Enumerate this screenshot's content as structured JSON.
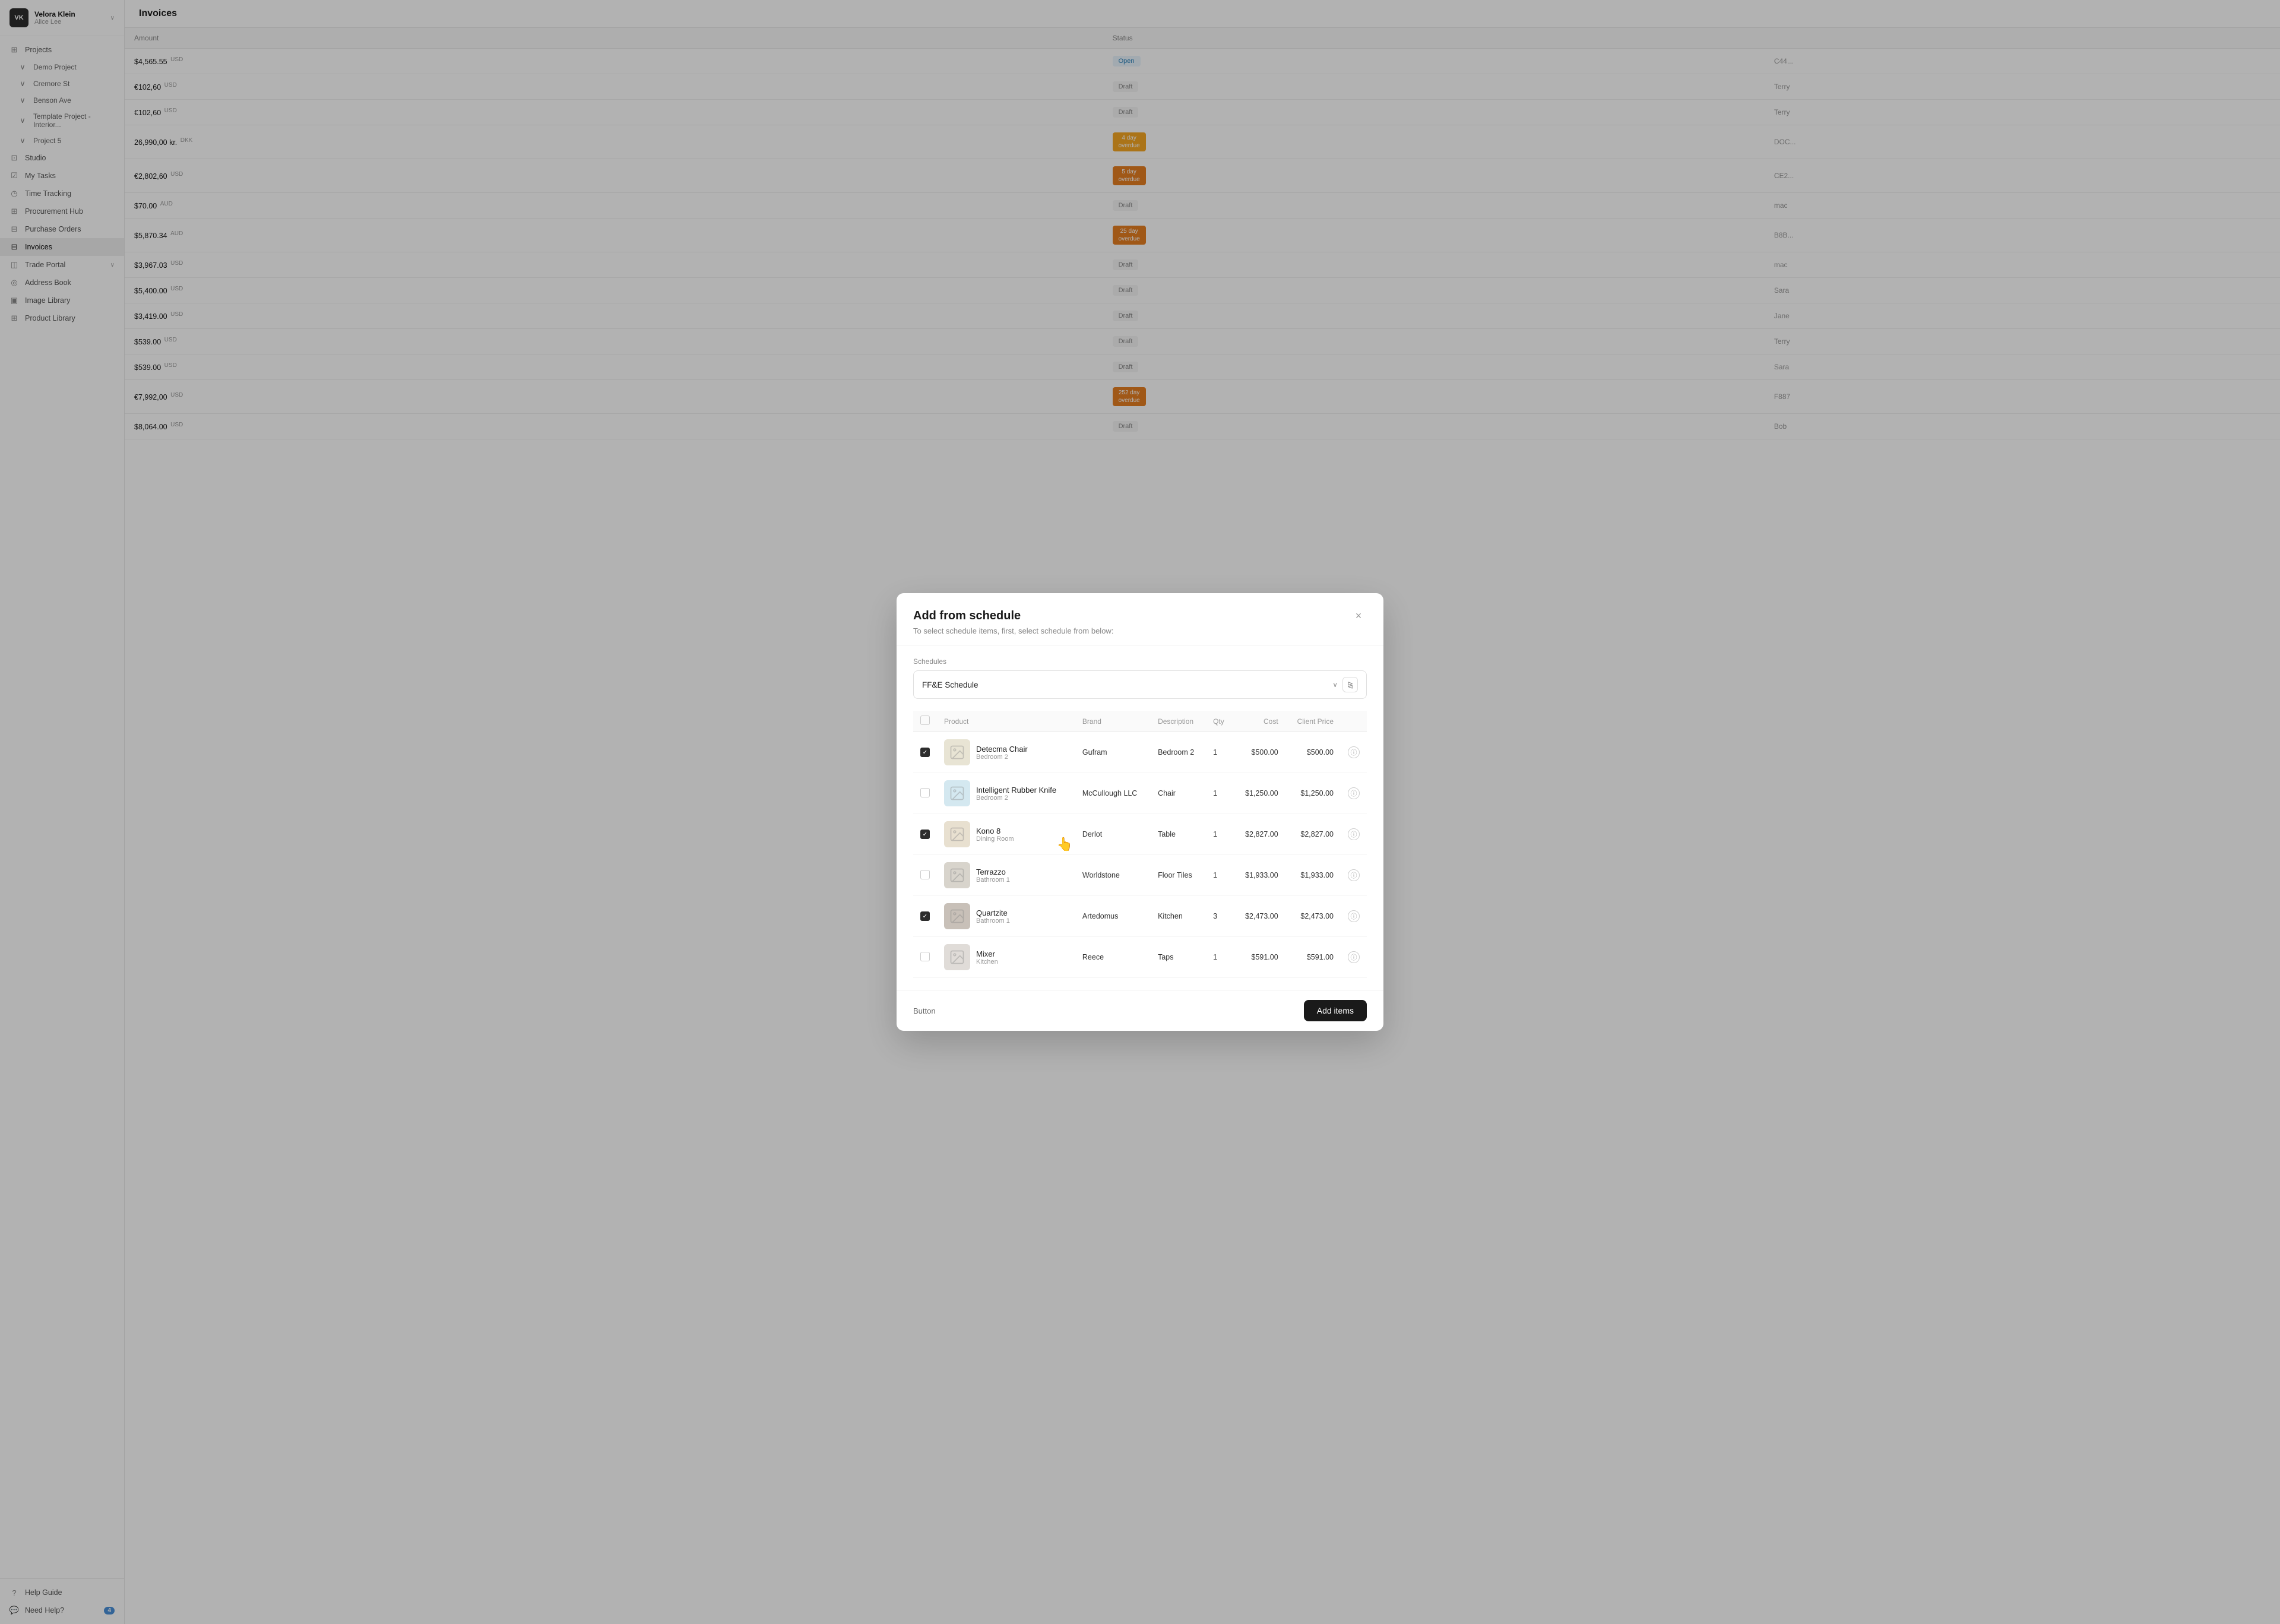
{
  "app": {
    "user": {
      "initials": "VK",
      "name": "Velora Klein",
      "sub": "Alice Lee"
    }
  },
  "sidebar": {
    "nav": [
      {
        "id": "projects",
        "label": "Projects",
        "icon": "⊞",
        "type": "item"
      },
      {
        "id": "demo-project",
        "label": "Demo Project",
        "icon": "∨",
        "type": "sub"
      },
      {
        "id": "cremore-st",
        "label": "Cremore St",
        "icon": "∨",
        "type": "sub"
      },
      {
        "id": "benson-ave",
        "label": "Benson Ave",
        "icon": "∨",
        "type": "sub"
      },
      {
        "id": "template-project",
        "label": "Template Project - Interior...",
        "icon": "∨",
        "type": "sub"
      },
      {
        "id": "project-5",
        "label": "Project 5",
        "icon": "∨",
        "type": "sub"
      },
      {
        "id": "studio",
        "label": "Studio",
        "icon": "⊡",
        "type": "item"
      },
      {
        "id": "my-tasks",
        "label": "My Tasks",
        "icon": "☑",
        "type": "item"
      },
      {
        "id": "time-tracking",
        "label": "Time Tracking",
        "icon": "◷",
        "type": "item"
      },
      {
        "id": "procurement-hub",
        "label": "Procurement Hub",
        "icon": "⊞",
        "type": "item"
      },
      {
        "id": "purchase-orders",
        "label": "Purchase Orders",
        "icon": "⊟",
        "type": "item"
      },
      {
        "id": "invoices",
        "label": "Invoices",
        "icon": "⊟",
        "type": "item",
        "active": true
      },
      {
        "id": "trade-portal",
        "label": "Trade Portal",
        "icon": "◫",
        "type": "item",
        "hasArrow": true
      },
      {
        "id": "address-book",
        "label": "Address Book",
        "icon": "◎",
        "type": "item"
      },
      {
        "id": "image-library",
        "label": "Image Library",
        "icon": "▣",
        "type": "item"
      },
      {
        "id": "product-library",
        "label": "Product Library",
        "icon": "⊞",
        "type": "item"
      }
    ],
    "footer": [
      {
        "id": "help-guide",
        "label": "Help Guide",
        "icon": "?"
      },
      {
        "id": "need-help",
        "label": "Need Help?",
        "icon": "💬",
        "badge": "4"
      }
    ]
  },
  "main": {
    "title": "Invoices",
    "table": {
      "columns": [
        "Amount",
        "Status",
        ""
      ],
      "rows": [
        {
          "amount": "$4,565.55",
          "currency": "USD",
          "status": "Open",
          "statusType": "open",
          "ref": "C44..."
        },
        {
          "amount": "€102,60",
          "currency": "USD",
          "status": "Draft",
          "statusType": "draft",
          "ref": "Terry"
        },
        {
          "amount": "€102,60",
          "currency": "USD",
          "status": "Draft",
          "statusType": "draft",
          "ref": "Terry"
        },
        {
          "amount": "26,990,00 kr.",
          "currency": "DKK",
          "status": "4 day overdue",
          "statusType": "overdue-4",
          "ref": "DOC..."
        },
        {
          "amount": "€2,802,60",
          "currency": "USD",
          "status": "5 day overdue",
          "statusType": "overdue-5",
          "ref": "CE2..."
        },
        {
          "amount": "$70.00",
          "currency": "AUD",
          "status": "Draft",
          "statusType": "draft",
          "ref": "mac"
        },
        {
          "amount": "$5,870.34",
          "currency": "AUD",
          "status": "25 day overdue",
          "statusType": "overdue-25",
          "ref": "B8B..."
        },
        {
          "amount": "$3,967.03",
          "currency": "USD",
          "status": "Draft",
          "statusType": "draft",
          "ref": "mac"
        },
        {
          "amount": "$5,400.00",
          "currency": "USD",
          "status": "Draft",
          "statusType": "draft",
          "ref": "Sara"
        },
        {
          "amount": "$3,419.00",
          "currency": "USD",
          "status": "Draft",
          "statusType": "draft",
          "ref": "Jane"
        },
        {
          "amount": "$539.00",
          "currency": "USD",
          "status": "Draft",
          "statusType": "draft",
          "ref": "Terry"
        },
        {
          "amount": "$539.00",
          "currency": "USD",
          "status": "Draft",
          "statusType": "draft",
          "ref": "Sara"
        },
        {
          "amount": "€7,992,00",
          "currency": "USD",
          "status": "252 day overdue",
          "statusType": "overdue-252",
          "ref": "F887"
        },
        {
          "amount": "$8,064.00",
          "currency": "USD",
          "status": "Draft",
          "statusType": "draft",
          "ref": "Bob"
        }
      ]
    }
  },
  "modal": {
    "title": "Add from schedule",
    "subtitle": "To select schedule items, first, select schedule from below:",
    "schedules_label": "Schedules",
    "schedule_selected": "FF&E Schedule",
    "close_label": "×",
    "table": {
      "columns": [
        "Product",
        "Brand",
        "Description",
        "Qty",
        "Cost",
        "Client Price"
      ],
      "rows": [
        {
          "checked": true,
          "name": "Detecma Chair",
          "sub": "Bedroom 2",
          "brand": "Gufram",
          "description": "Bedroom 2",
          "qty": 1,
          "cost": "$500.00",
          "client_price": "$500.00",
          "thumb_color": "chair"
        },
        {
          "checked": false,
          "name": "Intelligent Rubber Knife",
          "sub": "Bedroom 2",
          "brand": "McCullough LLC",
          "description": "Chair",
          "qty": 1,
          "cost": "$1,250.00",
          "client_price": "$1,250.00",
          "thumb_color": "knife"
        },
        {
          "checked": true,
          "name": "Kono 8",
          "sub": "Dining Room",
          "brand": "Derlot",
          "description": "Table",
          "qty": 1,
          "cost": "$2,827.00",
          "client_price": "$2,827.00",
          "thumb_color": "kono"
        },
        {
          "checked": false,
          "name": "Terrazzo",
          "sub": "Bathroom 1",
          "brand": "Worldstone",
          "description": "Floor Tiles",
          "qty": 1,
          "cost": "$1,933.00",
          "client_price": "$1,933.00",
          "thumb_color": "terrazzo"
        },
        {
          "checked": true,
          "name": "Quartzite",
          "sub": "Bathroom 1",
          "brand": "Artedomus",
          "description": "Kitchen",
          "qty": 3,
          "cost": "$2,473.00",
          "client_price": "$2,473.00",
          "thumb_color": "quartz"
        },
        {
          "checked": false,
          "name": "Mixer",
          "sub": "Kitchen",
          "brand": "Reece",
          "description": "Taps",
          "qty": 1,
          "cost": "$591.00",
          "client_price": "$591.00",
          "thumb_color": "mixer"
        }
      ]
    },
    "footer": {
      "button_label": "Button",
      "add_label": "Add items"
    }
  }
}
